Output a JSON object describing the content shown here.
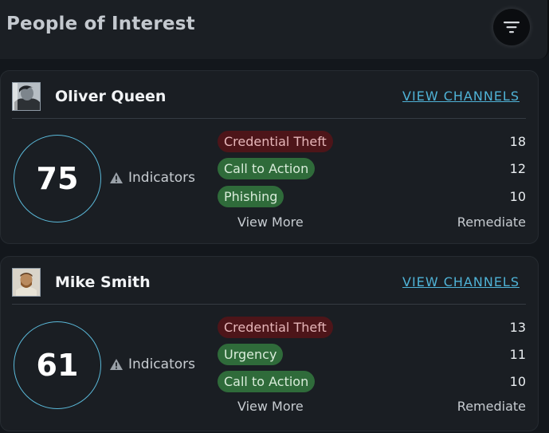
{
  "header": {
    "title": "People of Interest",
    "filter_icon": "filter-lines-icon"
  },
  "people": [
    {
      "name": "Oliver Queen",
      "avatar_icon": "user-photo-icon",
      "view_channels_label": "VIEW CHANNELS",
      "score": "75",
      "indicators_label": "Indicators",
      "warning_icon": "warning-triangle-icon",
      "tags": [
        {
          "label": "Credential Theft",
          "count": "18",
          "color": "#4d1519"
        },
        {
          "label": "Call to Action",
          "count": "12",
          "color": "#2f6b3a"
        },
        {
          "label": "Phishing",
          "count": "10",
          "color": "#2f6b3a"
        }
      ],
      "view_more_label": "View More",
      "remediate_label": "Remediate"
    },
    {
      "name": "Mike Smith",
      "avatar_icon": "user-photo-icon",
      "view_channels_label": "VIEW CHANNELS",
      "score": "61",
      "indicators_label": "Indicators",
      "warning_icon": "warning-triangle-icon",
      "tags": [
        {
          "label": "Credential Theft",
          "count": "13",
          "color": "#4d1519"
        },
        {
          "label": "Urgency",
          "count": "11",
          "color": "#2f6b3a"
        },
        {
          "label": "Call to Action",
          "count": "10",
          "color": "#2f6b3a"
        }
      ],
      "view_more_label": "View More",
      "remediate_label": "Remediate"
    }
  ],
  "colors": {
    "accent": "#4fb3d7",
    "tag_red": "#4d1519",
    "tag_green": "#2f6b3a",
    "background": "#13171c"
  }
}
